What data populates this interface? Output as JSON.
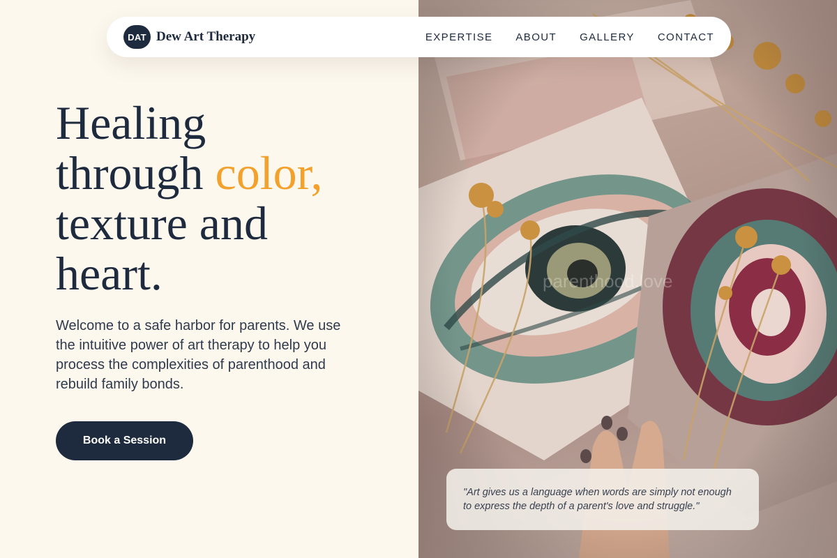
{
  "brand": {
    "badge": "DAT",
    "name": "Dew Art Therapy"
  },
  "nav": {
    "items": [
      "EXPERTISE",
      "ABOUT",
      "GALLERY",
      "CONTACT"
    ]
  },
  "hero": {
    "headline_line1": "Healing",
    "headline_line2a": "through",
    "headline_accent": "color,",
    "headline_line3": "texture and",
    "headline_line4": "heart.",
    "intro": "Welcome to a safe harbor for parents. We use the intuitive power of art therapy to help you process the complexities of parenthood and rebuild family bonds.",
    "cta_label": "Book a Session"
  },
  "image": {
    "watermark": "parenthood.love"
  },
  "quote": {
    "text": "\"Art gives us a language when words are simply not enough to express the depth of a parent's love and struggle.\""
  },
  "colors": {
    "navy": "#1e2a3d",
    "accent": "#f2a12c",
    "background": "#fdf8ee"
  }
}
